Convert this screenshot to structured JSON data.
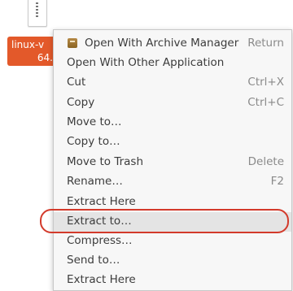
{
  "desktop": {
    "file_label_line1": "linux-v",
    "file_label_line2": "64."
  },
  "menu": {
    "items": [
      {
        "label": "Open With Archive Manager",
        "accel": "Return",
        "icon": "archive-manager-icon"
      },
      {
        "label": "Open With Other Application",
        "accel": ""
      },
      {
        "label": "Cut",
        "accel": "Ctrl+X"
      },
      {
        "label": "Copy",
        "accel": "Ctrl+C"
      },
      {
        "label": "Move to…",
        "accel": ""
      },
      {
        "label": "Copy to…",
        "accel": ""
      },
      {
        "label": "Move to Trash",
        "accel": "Delete"
      },
      {
        "label": "Rename…",
        "accel": "F2"
      },
      {
        "label": "Extract Here",
        "accel": ""
      },
      {
        "label": "Extract to…",
        "accel": "",
        "highlighted": true
      },
      {
        "label": "Compress…",
        "accel": ""
      },
      {
        "label": "Send to…",
        "accel": ""
      },
      {
        "label": "Extract Here",
        "accel": ""
      }
    ]
  },
  "colors": {
    "selection_orange": "#e3592a",
    "highlight_ring": "#d33a2b"
  }
}
